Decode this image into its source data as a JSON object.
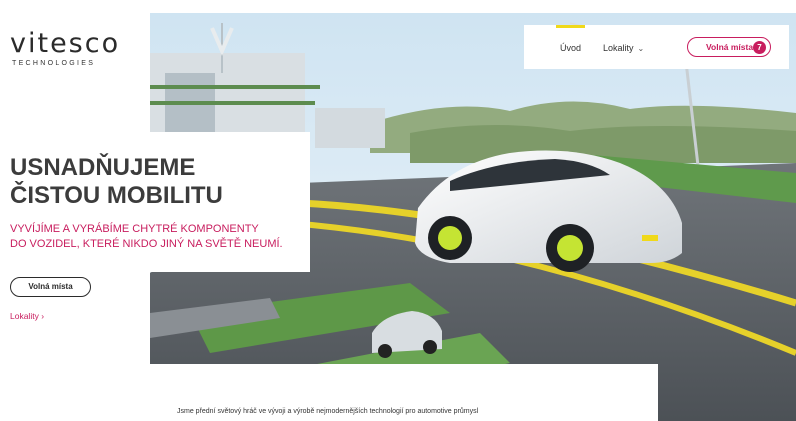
{
  "brand": {
    "logo_text": "vitesco",
    "logo_subtext": "TECHNOLOGIES"
  },
  "nav": {
    "items": [
      {
        "label": "Úvod",
        "active": true
      },
      {
        "label": "Lokality",
        "has_dropdown": true
      }
    ],
    "jobs_label": "Volná místa",
    "jobs_badge": "7"
  },
  "hero": {
    "headline_line1": "USNADŇUJEME",
    "headline_line2": "ČISTOU MOBILITU",
    "subline_line1": "VYVÍJÍME A VYRÁBÍME CHYTRÉ KOMPONENTY",
    "subline_line2": "DO VOZIDEL, KTERÉ NIKDO JINÝ NA SVĚTĚ NEUMÍ.",
    "cta_label": "Volná místa",
    "locations_link": "Lokality"
  },
  "tagline": "Jsme přední světový hráč ve vývoji a výrobě nejmodernějších technologií pro automotive průmysl",
  "colors": {
    "brand": "#c81d5e",
    "accent_yellow": "#f0d91a",
    "headline": "#3c3c3c"
  },
  "icons": [
    "chevron-down-icon",
    "chevron-right-icon"
  ]
}
